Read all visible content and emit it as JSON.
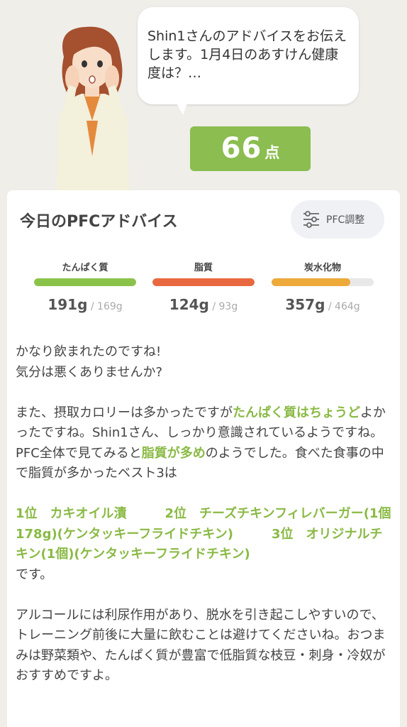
{
  "header": {
    "speech": "Shin1さんのアドバイスをお伝えします。1月4日のあすけん健康度は？…",
    "score": "66",
    "score_unit": "点"
  },
  "card": {
    "title": "今日のPFCアドバイス",
    "pfc_button_label": "PFC調整",
    "macros": [
      {
        "label": "たんぱく質",
        "amount": "191g",
        "target": "169g",
        "fill_ratio": 1.0,
        "color": "#8bc34a"
      },
      {
        "label": "脂質",
        "amount": "124g",
        "target": "93g",
        "fill_ratio": 1.0,
        "color": "#e8693f"
      },
      {
        "label": "炭水化物",
        "amount": "357g",
        "target": "464g",
        "fill_ratio": 0.77,
        "color": "#eda93a"
      }
    ]
  },
  "advice": {
    "p1_line1": "かなり飲まれたのですね!",
    "p1_line2": "気分は悪くありませんか?",
    "p2_a": "また、摂取カロリーは多かったですが",
    "p2_hl": "たんぱく質はちょうど",
    "p2_b": "よかったですね。Shin1さん、しっかり意識されているようですね。",
    "p3_a": "PFC全体で見てみると",
    "p3_hl": "脂質が多め",
    "p3_b": "のようでした。食べた食事の中で脂質が多かったベスト3は",
    "ranking": "1位　カキオイル漬　　　2位　チーズチキンフィレバーガー(1個178g)(ケンタッキーフライドチキン)　　　3位　オリジナルチキン(1個)(ケンタッキーフライドチキン)",
    "ranking_suffix": "です。",
    "p4": "アルコールには利尿作用があり、脱水を引き起こしやすいので、トレーニング前後に大量に飲むことは避けてくださいね。おつまみは野菜類や、たんぱく質が豊富で低脂質な枝豆・刺身・冷奴がおすすめですよ。"
  }
}
